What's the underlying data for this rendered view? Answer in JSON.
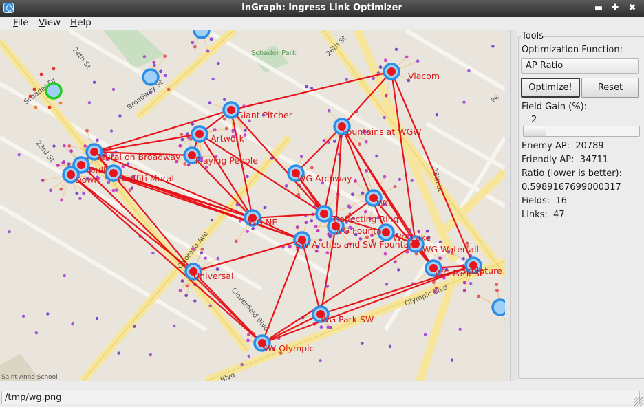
{
  "window": {
    "title": "InGraph: Ingress Link Optimizer",
    "controls": {
      "minimize": "▬",
      "maximize": "✚",
      "close": "✖"
    }
  },
  "menubar": [
    {
      "label": "File",
      "mnemonic": "F",
      "rest": "ile"
    },
    {
      "label": "View",
      "mnemonic": "V",
      "rest": "iew"
    },
    {
      "label": "Help",
      "mnemonic": "H",
      "rest": "elp"
    }
  ],
  "map": {
    "street_labels": [
      "Schader Park",
      "26th St",
      "24th St",
      "Broadway St",
      "23rd St",
      "Schader Dr",
      "Colorado Ave",
      "Cloverfield Blvd",
      "Olympic Blvd",
      "Blvd",
      "Saint Anne School",
      "Pe"
    ],
    "portal_labels": [
      "Viacom",
      "Giant Pitcher",
      "Artwork",
      "Fountains at WGW",
      "Mural on Broadway",
      "Playing People",
      "Dulli",
      "Down",
      "Graffiti Mural",
      "WG Archway",
      "WG",
      "WG NE",
      "Reflecting Ring",
      "WG Fountain",
      "WG Lake",
      "SW Arches and SW Fountain",
      "WG Waterfall",
      "WG Park SE",
      "Sculpture",
      "Universal",
      "WG Park SW",
      "SW Olympic"
    ],
    "colors": {
      "link": "#e8161c",
      "portal": "#2d8ee8",
      "selected_portal": "#22cc22",
      "label": "#d81818"
    }
  },
  "tools": {
    "group_label": "Tools",
    "optimization_label": "Optimization Function:",
    "optimization_value": "AP Ratio",
    "optimize_button": "Optimize!",
    "reset_button": "Reset",
    "field_gain_label": "Field Gain (%):",
    "field_gain_value": "2",
    "enemy_ap_label": "Enemy AP:",
    "enemy_ap_value": "20789",
    "friendly_ap_label": "Friendly AP:",
    "friendly_ap_value": "34711",
    "ratio_label": "Ratio (lower is better):",
    "ratio_value": "0.5989167699000317",
    "fields_label": "Fields:",
    "fields_value": "16",
    "links_label": "Links:",
    "links_value": "47"
  },
  "status": {
    "path": "/tmp/wg.png"
  }
}
